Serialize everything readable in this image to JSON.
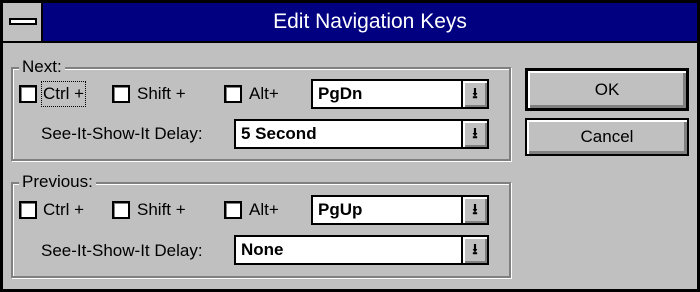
{
  "window": {
    "title": "Edit Navigation Keys"
  },
  "next": {
    "group_label": "Next:",
    "ctrl_label": "Ctrl +",
    "shift_label": "Shift +",
    "alt_label": "Alt+",
    "key_value": "PgDn",
    "delay_label": "See-It-Show-It Delay:",
    "delay_value": "5 Second"
  },
  "previous": {
    "group_label": "Previous:",
    "ctrl_label": "Ctrl +",
    "shift_label": "Shift +",
    "alt_label": "Alt+",
    "key_value": "PgUp",
    "delay_label": "See-It-Show-It Delay:",
    "delay_value": "None"
  },
  "buttons": {
    "ok": "OK",
    "cancel": "Cancel"
  },
  "icons": {
    "system_menu": "system-menu-icon",
    "dropdown": "down-arrow-icon"
  }
}
